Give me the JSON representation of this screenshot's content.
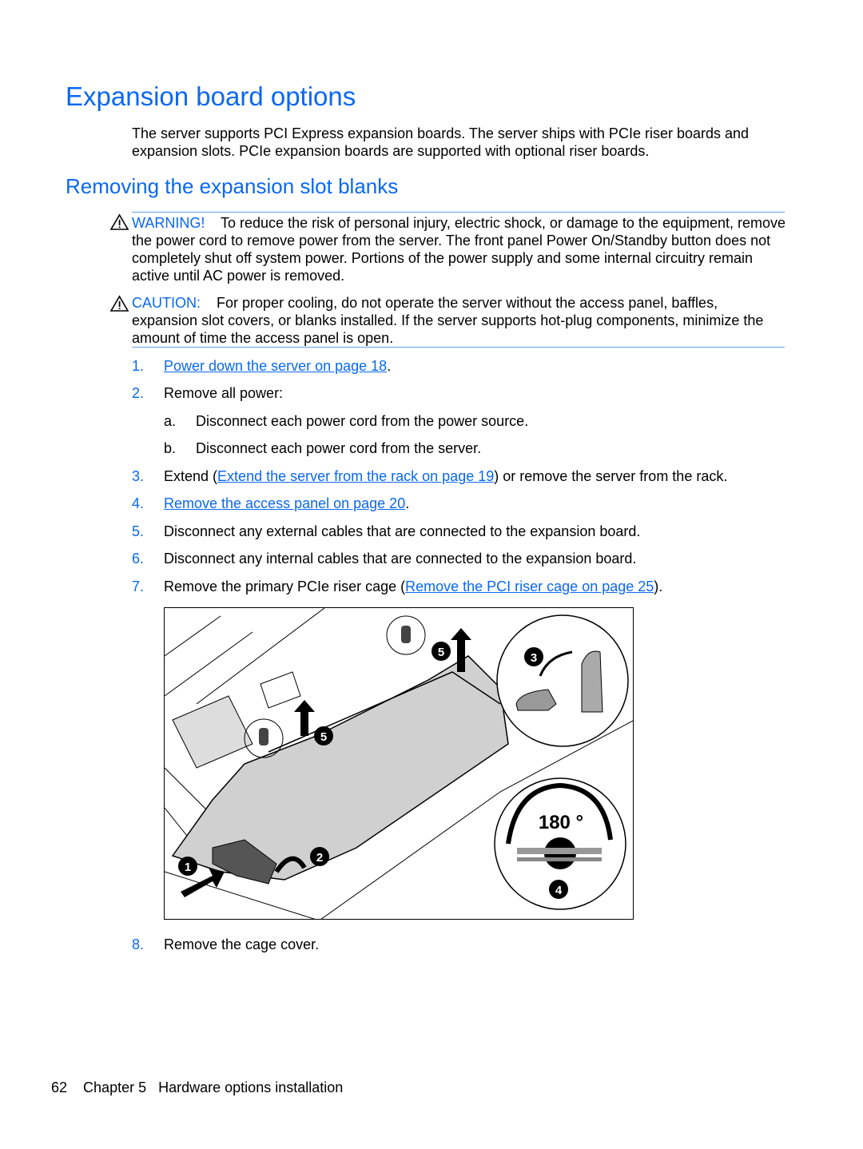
{
  "title": "Expansion board options",
  "intro": "The server supports PCI Express expansion boards. The server ships with PCIe riser boards and expansion slots. PCIe expansion boards are supported with optional riser boards.",
  "section_title": "Removing the expansion slot blanks",
  "warning": {
    "label": "WARNING!",
    "text": "To reduce the risk of personal injury, electric shock, or damage to the equipment, remove the power cord to remove power from the server. The front panel Power On/Standby button does not completely shut off system power. Portions of the power supply and some internal circuitry remain active until AC power is removed.",
    "icon": "warning-triangle-icon"
  },
  "caution": {
    "label": "CAUTION:",
    "text": "For proper cooling, do not operate the server without the access panel, baffles, expansion slot covers, or blanks installed. If the server supports hot-plug components, minimize the amount of time the access panel is open.",
    "icon": "warning-triangle-icon"
  },
  "steps": [
    {
      "num": "1.",
      "link": "Power down the server on page 18",
      "after": "."
    },
    {
      "num": "2.",
      "text": "Remove all power:",
      "substeps": [
        {
          "num": "a.",
          "text": "Disconnect each power cord from the power source."
        },
        {
          "num": "b.",
          "text": "Disconnect each power cord from the server."
        }
      ]
    },
    {
      "num": "3.",
      "before": "Extend (",
      "link": "Extend the server from the rack on page 19",
      "after": ") or remove the server from the rack."
    },
    {
      "num": "4.",
      "link": "Remove the access panel on page 20",
      "after": "."
    },
    {
      "num": "5.",
      "text": "Disconnect any external cables that are connected to the expansion board."
    },
    {
      "num": "6.",
      "text": "Disconnect any internal cables that are connected to the expansion board."
    },
    {
      "num": "7.",
      "before": "Remove the primary PCIe riser cage (",
      "link": "Remove the PCI riser cage on page 25",
      "after": ")."
    },
    {
      "num": "8.",
      "text": "Remove the cage cover."
    }
  ],
  "figure": {
    "callouts": [
      "1",
      "2",
      "3",
      "4",
      "5",
      "5"
    ],
    "angle_label": "180 °"
  },
  "footer": {
    "page": "62",
    "chapter": "Chapter 5",
    "chapter_title": "Hardware options installation"
  },
  "colors": {
    "heading": "#0a68f2",
    "link": "#0a68f2",
    "rule": "#6a9ef5"
  }
}
